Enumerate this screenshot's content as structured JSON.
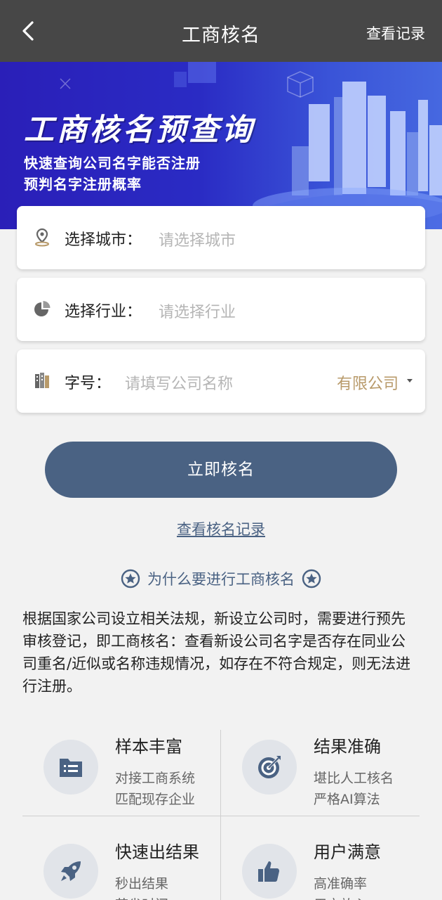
{
  "header": {
    "title": "工商核名",
    "right_link": "查看记录",
    "back_icon": "chevron-left-icon"
  },
  "banner": {
    "title": "工商核名预查询",
    "subtitle_1": "快速查询公司名字能否注册",
    "subtitle_2": "预判名字注册概率"
  },
  "form": {
    "city": {
      "label": "选择城市：",
      "placeholder": "请选择城市",
      "icon": "location-pin-icon"
    },
    "industry": {
      "label": "选择行业：",
      "placeholder": "请选择行业",
      "icon": "pie-chart-icon"
    },
    "name": {
      "label": "字号：",
      "placeholder": "请填写公司名称",
      "suffix": "有限公司",
      "icon": "building-icon"
    }
  },
  "actions": {
    "submit": "立即核名",
    "history": "查看核名记录"
  },
  "why": {
    "title": "为什么要进行工商核名"
  },
  "description": "根据国家公司设立相关法规，新设立公司时，需要进行预先审核登记，即工商核名：查看新设公司名字是否存在同业公司重名/近似或名称违规情况，如存在不符合规定，则无法进行注册。",
  "features": [
    {
      "title": "样本丰富",
      "line1": "对接工商系统",
      "line2": "匹配现存企业",
      "icon": "list-card-icon"
    },
    {
      "title": "结果准确",
      "line1": "堪比人工核名",
      "line2": "严格AI算法",
      "icon": "target-icon"
    },
    {
      "title": "快速出结果",
      "line1": "秒出结果",
      "line2": "节省时间",
      "icon": "rocket-icon"
    },
    {
      "title": "用户满意",
      "line1": "高准确率",
      "line2": "用户放心",
      "icon": "thumbs-up-icon"
    }
  ],
  "colors": {
    "header_bg": "#474747",
    "accent": "#4a6283",
    "suffix": "#b89a6a",
    "banner": "#2a2bc4"
  }
}
